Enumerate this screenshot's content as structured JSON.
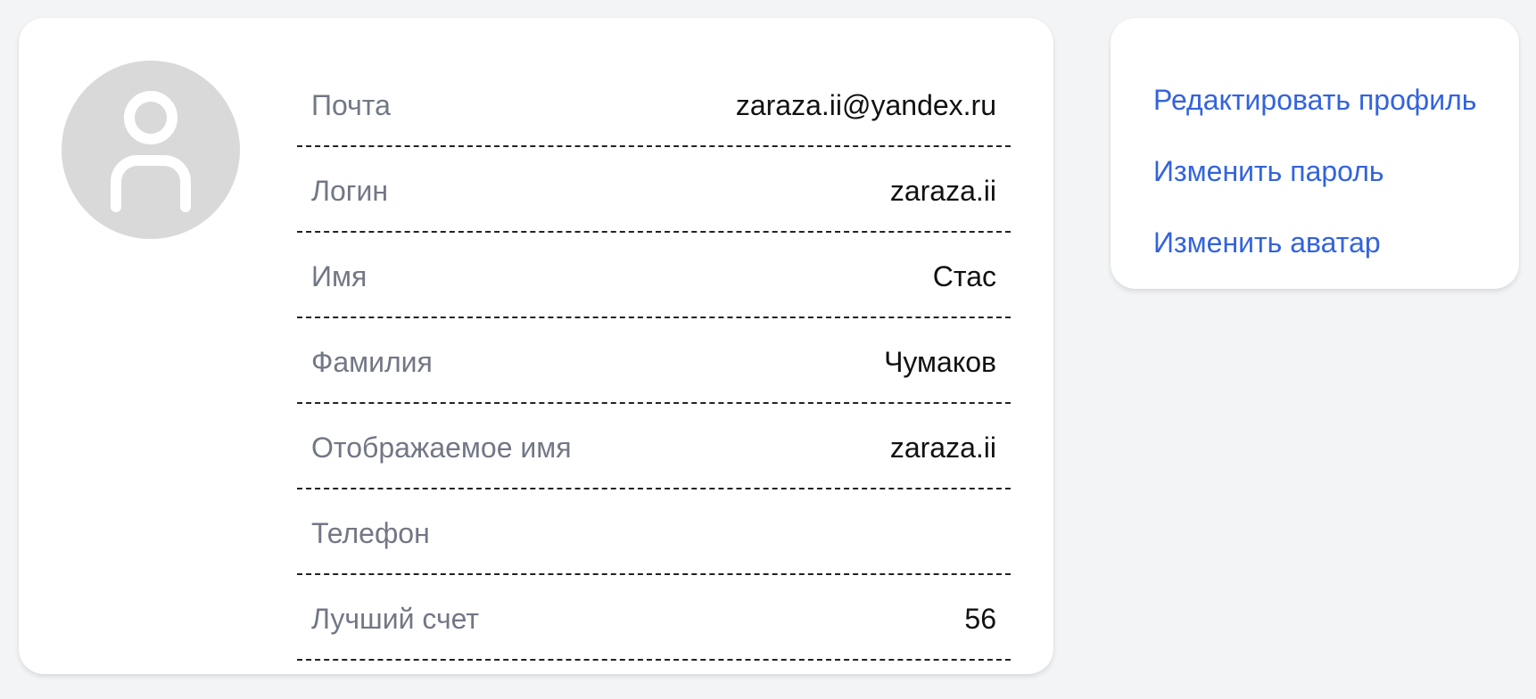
{
  "profile": {
    "avatar_icon": "user-icon",
    "fields": [
      {
        "label": "Почта",
        "value": "zaraza.ii@yandex.ru"
      },
      {
        "label": "Логин",
        "value": "zaraza.ii"
      },
      {
        "label": "Имя",
        "value": "Стас"
      },
      {
        "label": "Фамилия",
        "value": "Чумаков"
      },
      {
        "label": "Отображаемое имя",
        "value": "zaraza.ii"
      },
      {
        "label": "Телефон",
        "value": ""
      },
      {
        "label": "Лучший счет",
        "value": "56"
      }
    ]
  },
  "actions": {
    "edit_profile": "Редактировать профиль",
    "change_password": "Изменить пароль",
    "change_avatar": "Изменить аватар"
  },
  "colors": {
    "background": "#f3f4f6",
    "card": "#ffffff",
    "link": "#3363dd",
    "label": "#727785",
    "avatar": "#d9d9d9"
  }
}
